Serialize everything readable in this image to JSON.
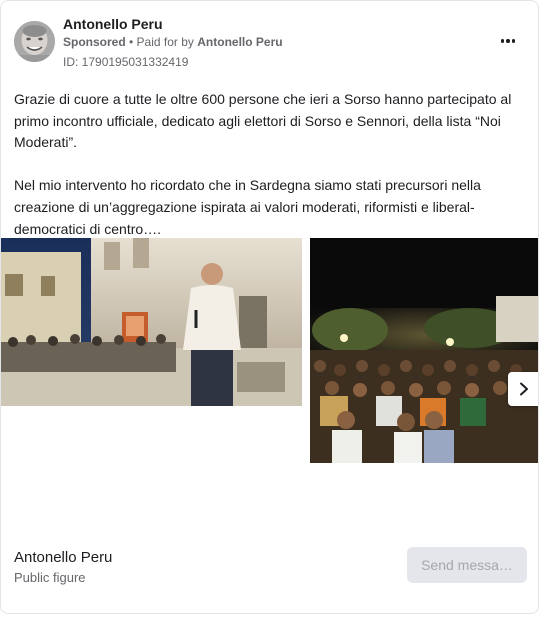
{
  "header": {
    "page_name": "Antonello Peru",
    "sponsored": "Sponsored",
    "separator": " • ",
    "paid_for_prefix": "Paid for by ",
    "paid_for_name": "Antonello Peru",
    "ad_id": "ID: 1790195031332419",
    "more_icon": "more-horizontal-icon"
  },
  "post": {
    "paragraphs": [
      "Grazie di cuore a tutte le oltre 600 persone che ieri a Sorso hanno partecipato al primo incontro ufficiale, dedicato agli elettori di Sorso e Sennori, della lista “Noi Moderati”.",
      "Nel mio intervento ho ricordato che in Sardegna siamo stati precursori nella creazione di un’aggregazione ispirata ai valori moderati, riformisti e liberal-democratici di centro…."
    ]
  },
  "carousel": {
    "next_icon": "chevron-right-icon"
  },
  "footer": {
    "name": "Antonello Peru",
    "category": "Public figure",
    "button_label": "Send messa…"
  },
  "colors": {
    "text_primary": "#1c1e21",
    "text_secondary": "#65676b",
    "button_bg": "#e4e6eb",
    "button_text": "#a4a7ab"
  }
}
